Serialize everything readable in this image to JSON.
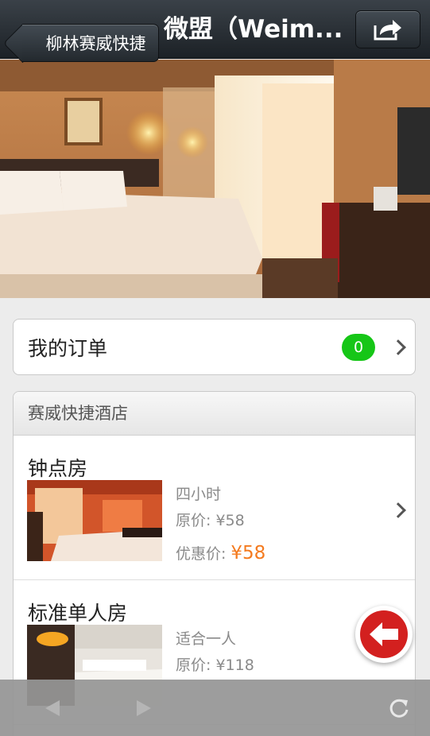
{
  "navbar": {
    "back_label": "柳林赛威快捷",
    "title": "微盟（Weim..."
  },
  "orders": {
    "label": "我的订单",
    "count": "0"
  },
  "hotel": {
    "section_title": "赛威快捷酒店",
    "rooms": [
      {
        "name": "钟点房",
        "desc": "四小时",
        "original_price": "原价: ¥58",
        "discount_label": "优惠价:",
        "discount_price": "¥58"
      },
      {
        "name": "标准单人房",
        "desc": "适合一人",
        "original_price": "原价: ¥118"
      }
    ]
  },
  "colors": {
    "badge": "#16c617",
    "discount": "#f47a1e",
    "float_button": "#d3201f"
  },
  "icons": [
    "share-icon",
    "chevron-right-icon",
    "back-arrow-icon",
    "prev-icon",
    "next-icon",
    "refresh-icon"
  ]
}
